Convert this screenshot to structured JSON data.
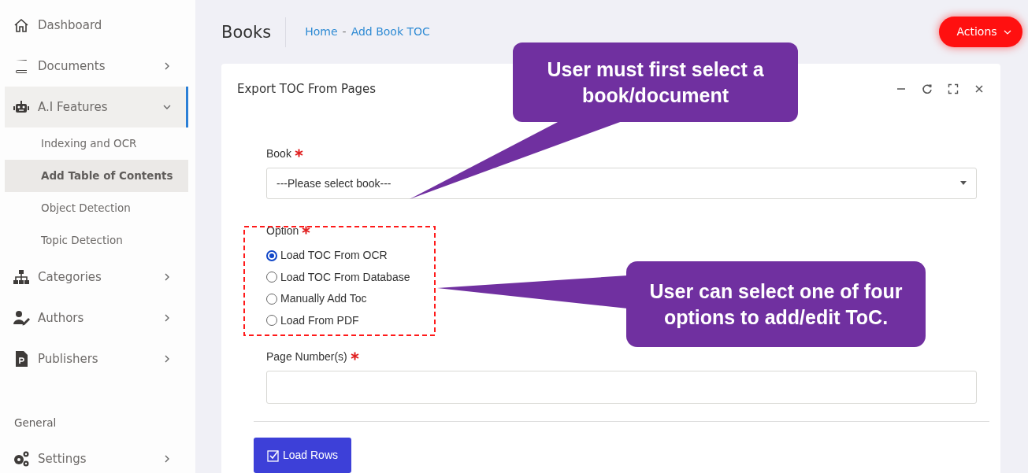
{
  "sidebar": {
    "items": [
      {
        "label": "Dashboard"
      },
      {
        "label": "Documents",
        "expanded": false
      },
      {
        "label": "A.I Features",
        "expanded": true,
        "children": [
          {
            "label": "Indexing and OCR",
            "selected": false
          },
          {
            "label": "Add Table of Contents",
            "selected": true
          },
          {
            "label": "Object Detection",
            "selected": false
          },
          {
            "label": "Topic Detection",
            "selected": false
          }
        ]
      },
      {
        "label": "Categories",
        "expanded": false
      },
      {
        "label": "Authors",
        "expanded": false
      },
      {
        "label": "Publishers",
        "expanded": false
      }
    ],
    "section": "General",
    "bottom_items": [
      {
        "label": "Settings",
        "expanded": false
      }
    ]
  },
  "header": {
    "title": "Books",
    "breadcrumb": [
      "Home",
      "Add Book TOC"
    ],
    "breadcrumb_separator": "-",
    "actions_button": "Actions"
  },
  "card": {
    "title": "Export TOC From Pages",
    "book": {
      "label": "Book",
      "required": true,
      "value": "---Please select book---"
    },
    "option": {
      "label": "Option",
      "required": true,
      "choices": [
        {
          "label": "Load TOC From OCR",
          "selected": true
        },
        {
          "label": "Load TOC From Database",
          "selected": false
        },
        {
          "label": "Manually Add Toc",
          "selected": false
        },
        {
          "label": "Load From PDF",
          "selected": false
        }
      ]
    },
    "page_numbers": {
      "label": "Page Number(s)",
      "required": true
    },
    "submit_button": "Load Rows"
  },
  "callouts": [
    {
      "text": "User must first select a book/document"
    },
    {
      "text": "User can select one of four options to add/edit ToC."
    }
  ]
}
